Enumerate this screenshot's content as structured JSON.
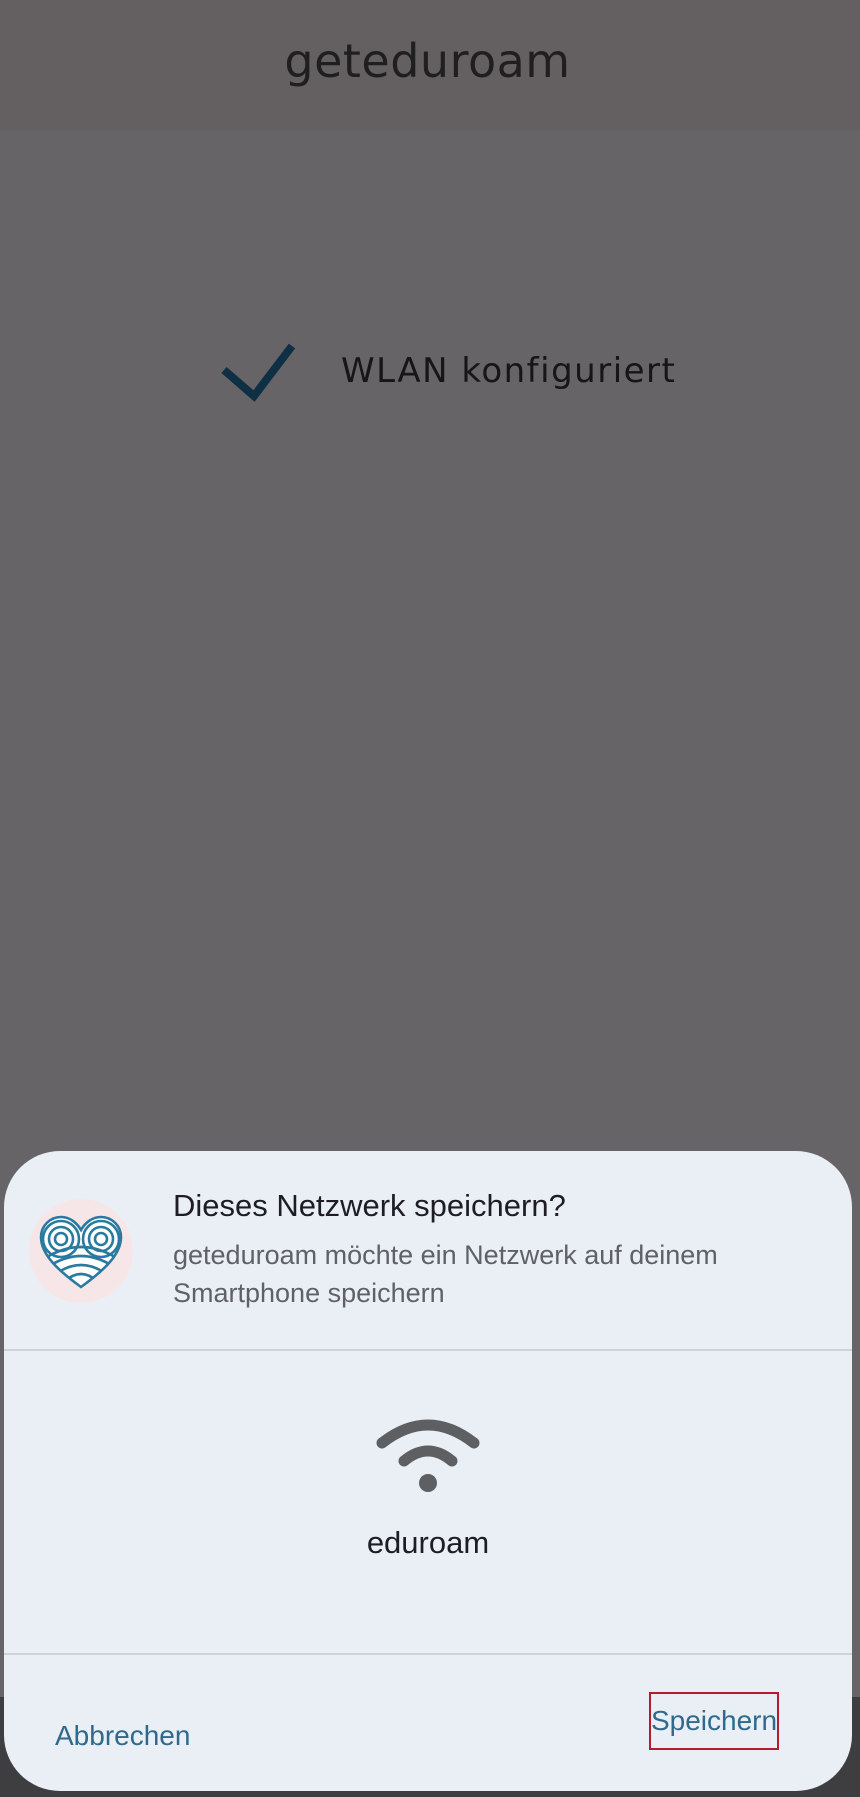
{
  "app_bar": {
    "title": "geteduroam"
  },
  "status": {
    "text": "WLAN konfiguriert",
    "icon": "checkmark-icon"
  },
  "dialog": {
    "title": "Dieses Netzwerk speichern?",
    "message": "geteduroam möchte ein Netzwerk auf deinem Smartphone speichern",
    "app_icon": "eduroam-heart-logo",
    "network_icon": "wifi-icon",
    "network_name": "eduroam",
    "buttons": {
      "cancel_label": "Abbrechen",
      "save_label": "Speichern"
    }
  },
  "colors": {
    "accent": "#2e6a8c",
    "sheet_background": "#eaeef5",
    "scrim": "#676467",
    "highlight": "#b01e2a"
  }
}
